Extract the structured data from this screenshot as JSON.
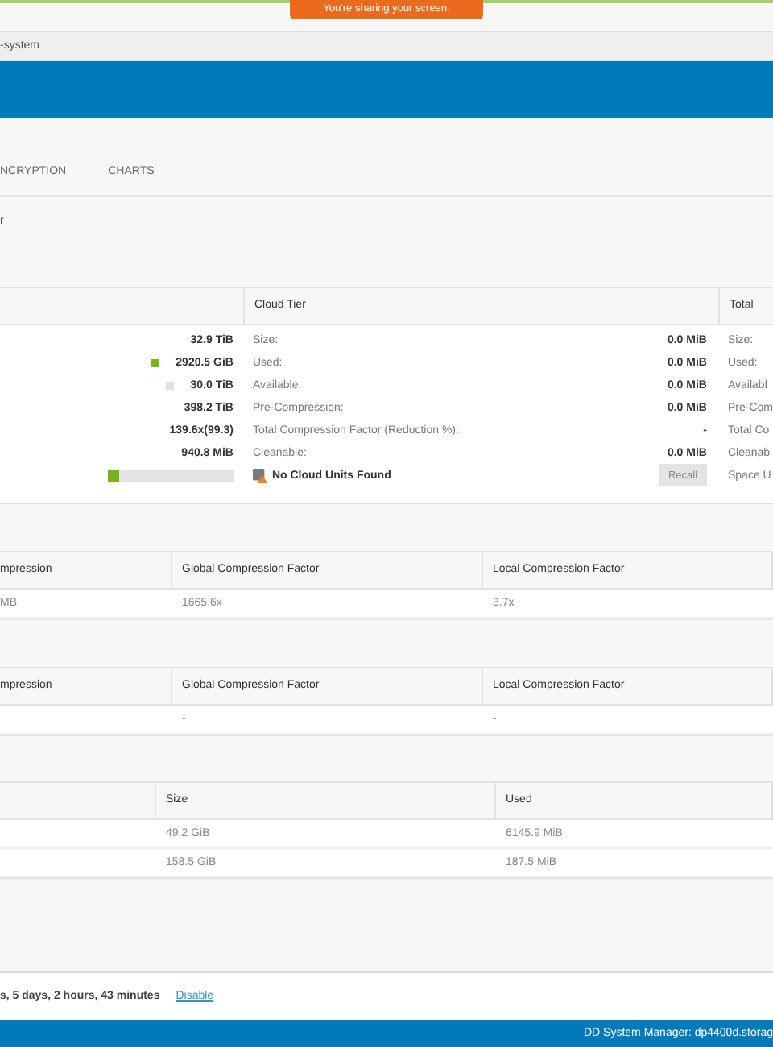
{
  "screen_share_banner": {
    "text": "You're sharing your screen."
  },
  "address_bar": {
    "text": "-system"
  },
  "tabs": [
    {
      "label": "NCRYPTION",
      "selected": false
    },
    {
      "label": "CHARTS",
      "selected": false
    }
  ],
  "section_label": "r",
  "space_usage": {
    "columns": [
      "Cloud Tier",
      "Total"
    ],
    "active_tier": [
      {
        "value": "32.9 TiB"
      },
      {
        "value": "2920.5 GiB",
        "color": "#7ab317"
      },
      {
        "value": "30.0 TiB",
        "color": "#e0e0e0"
      },
      {
        "value": "398.2 TiB"
      },
      {
        "value": "139.6x(99.3)"
      },
      {
        "value": "940.8 MiB"
      }
    ],
    "usage_bar": {
      "level": 0.09
    },
    "cloud_tier": [
      {
        "label": "Size:",
        "value": "0.0 MiB"
      },
      {
        "label": "Used:",
        "value": "0.0 MiB"
      },
      {
        "label": "Available:",
        "value": "0.0 MiB"
      },
      {
        "label": "Pre-Compression:",
        "value": "0.0 MiB"
      },
      {
        "label": "Total Compression Factor (Reduction %):",
        "value": "-"
      },
      {
        "label": "Cleanable:",
        "value": "0.0 MiB"
      }
    ],
    "cloud_status": "No Cloud Units Found",
    "recall_button": {
      "label": "Recall",
      "disabled": true
    },
    "total": [
      "Size:",
      "Used:",
      "Availabl",
      "Pre-Com",
      "Total Co",
      "Cleanab",
      "Space U"
    ]
  },
  "compression_tables": [
    {
      "columns": [
        "mpression",
        "Global Compression Factor",
        "Local Compression Factor"
      ],
      "rows": [
        [
          "MB",
          "1665.6x",
          "3.7x"
        ]
      ]
    },
    {
      "columns": [
        "mpression",
        "Global Compression Factor",
        "Local Compression Factor"
      ],
      "rows": [
        [
          null,
          "-",
          "-"
        ]
      ]
    }
  ],
  "size_table": {
    "columns": [
      "Size",
      "Used"
    ],
    "rows": [
      [
        "49.2 GiB",
        "6145.9 MiB"
      ],
      [
        "158.5 GiB",
        "187.5 MiB"
      ]
    ]
  },
  "footer": {
    "text": "s, 5 days, 2 hours, 43 minutes",
    "link": "Disable"
  },
  "status_bar": {
    "text": "DD System Manager: dp4400d.storag"
  }
}
